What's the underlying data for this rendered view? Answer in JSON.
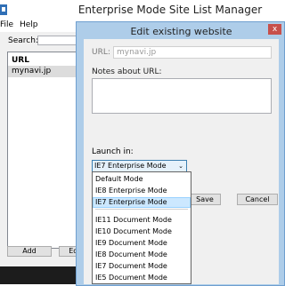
{
  "main_window": {
    "title": "Enterprise Mode Site List Manager",
    "menu": [
      "File",
      "Help"
    ],
    "search_label": "Search:",
    "list": {
      "header": "URL",
      "rows": [
        "mynavi.jp"
      ]
    },
    "buttons": [
      "Add",
      "Edit"
    ]
  },
  "dialog": {
    "title": "Edit existing website",
    "close_label": "x",
    "url_label": "URL:",
    "url_value": "mynavi.jp",
    "notes_label": "Notes about URL:",
    "launch_label": "Launch in:",
    "launch_selected": "IE7 Enterprise Mode",
    "save_label": "Save",
    "cancel_label": "Cancel"
  },
  "dropdown": {
    "options_group1": [
      "Default Mode",
      "IE8 Enterprise Mode",
      "IE7 Enterprise Mode"
    ],
    "options_group2": [
      "IE11 Document Mode",
      "IE10 Document Mode",
      "IE9 Document Mode",
      "IE8 Document Mode",
      "IE7 Document Mode",
      "IE5 Document Mode"
    ],
    "highlighted": "IE7 Enterprise Mode"
  },
  "colors": {
    "dialog_frame": "#aecde9",
    "close_button": "#c7504b",
    "selection": "#cce8ff"
  }
}
